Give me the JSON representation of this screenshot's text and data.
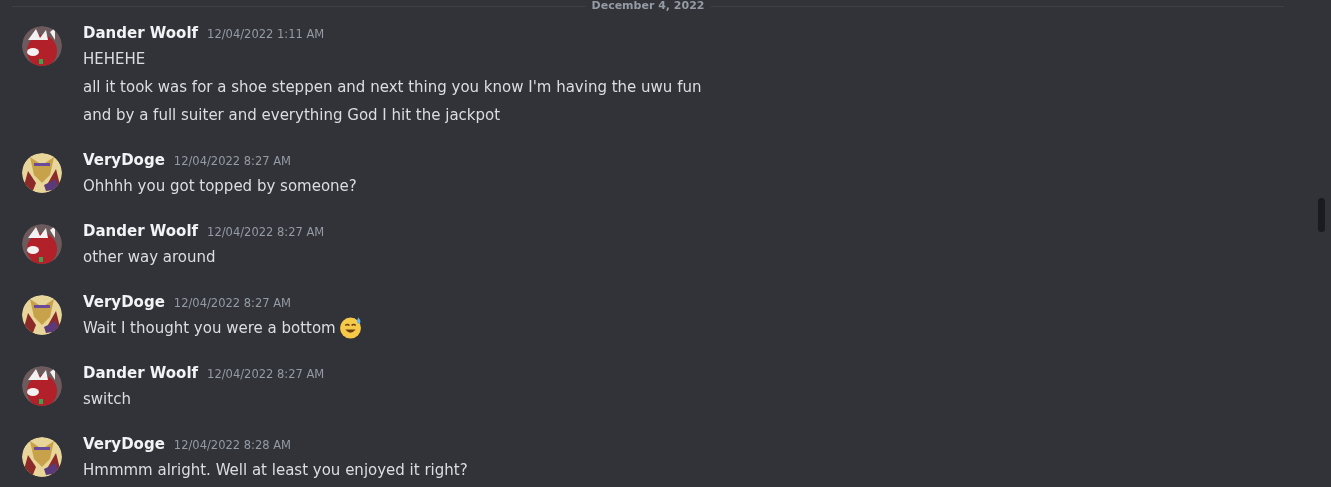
{
  "divider": {
    "label": "December 4, 2022"
  },
  "groups": [
    {
      "kind": "wolf",
      "author": "Dander Woolf",
      "timestamp": "12/04/2022 1:11 AM",
      "lines": [
        {
          "text": "HEHEHE",
          "emoji": false
        },
        {
          "text": "all it took was for a shoe steppen and next thing you know I'm having the uwu fun",
          "emoji": false
        },
        {
          "text": "and by a full suiter and everything God I hit the jackpot",
          "emoji": false
        }
      ]
    },
    {
      "kind": "beast",
      "author": "VeryDoge",
      "timestamp": "12/04/2022 8:27 AM",
      "lines": [
        {
          "text": "Ohhhh you got topped by someone?",
          "emoji": false
        }
      ]
    },
    {
      "kind": "wolf",
      "author": "Dander Woolf",
      "timestamp": "12/04/2022 8:27 AM",
      "lines": [
        {
          "text": "other way around",
          "emoji": false
        }
      ]
    },
    {
      "kind": "beast",
      "author": "VeryDoge",
      "timestamp": "12/04/2022 8:27 AM",
      "lines": [
        {
          "text": "Wait I thought you were a bottom",
          "emoji": true
        }
      ]
    },
    {
      "kind": "wolf",
      "author": "Dander Woolf",
      "timestamp": "12/04/2022 8:27 AM",
      "lines": [
        {
          "text": "switch",
          "emoji": false
        }
      ]
    },
    {
      "kind": "beast",
      "author": "VeryDoge",
      "timestamp": "12/04/2022 8:28 AM",
      "lines": [
        {
          "text": "Hmmmm alright. Well at least you enjoyed it right?",
          "emoji": false
        }
      ]
    }
  ]
}
